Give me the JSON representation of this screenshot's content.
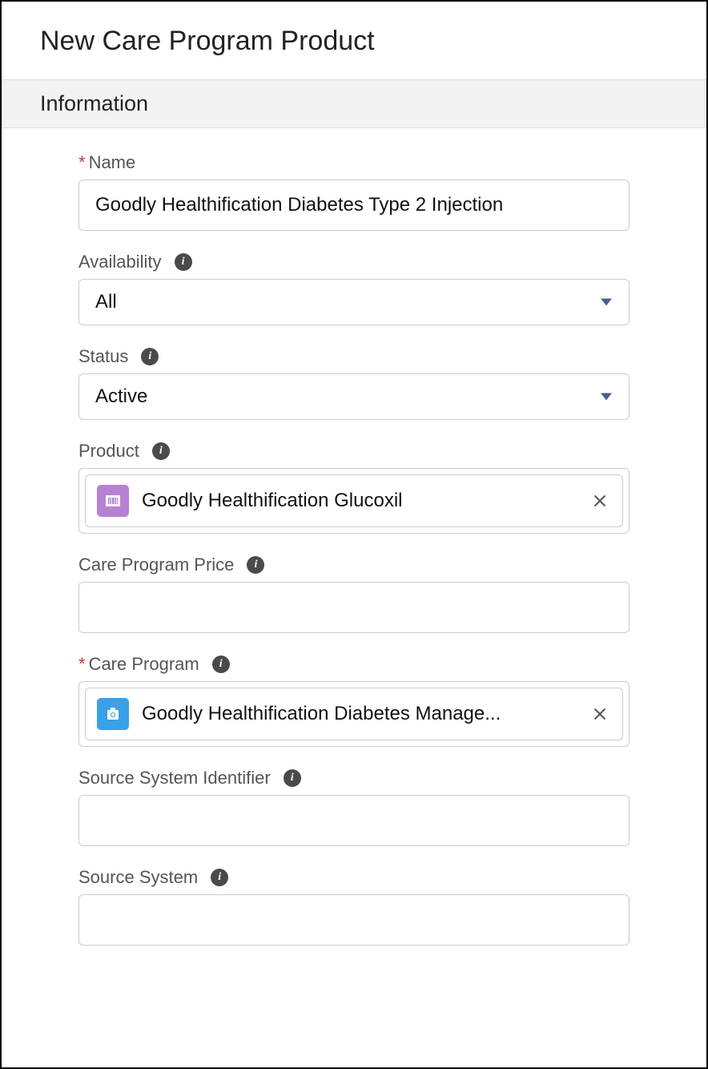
{
  "pageTitle": "New Care Program Product",
  "sectionTitle": "Information",
  "fields": {
    "name": {
      "label": "Name",
      "required": true,
      "value": "Goodly Healthification Diabetes Type 2 Injection"
    },
    "availability": {
      "label": "Availability",
      "value": "All"
    },
    "status": {
      "label": "Status",
      "value": "Active"
    },
    "product": {
      "label": "Product",
      "value": "Goodly Healthification Glucoxil"
    },
    "carePrice": {
      "label": "Care Program Price",
      "value": ""
    },
    "careProgram": {
      "label": "Care Program",
      "required": true,
      "value": "Goodly Healthification Diabetes Manage..."
    },
    "sourceSystemIdentifier": {
      "label": "Source System Identifier",
      "value": ""
    },
    "sourceSystem": {
      "label": "Source System",
      "value": ""
    }
  }
}
